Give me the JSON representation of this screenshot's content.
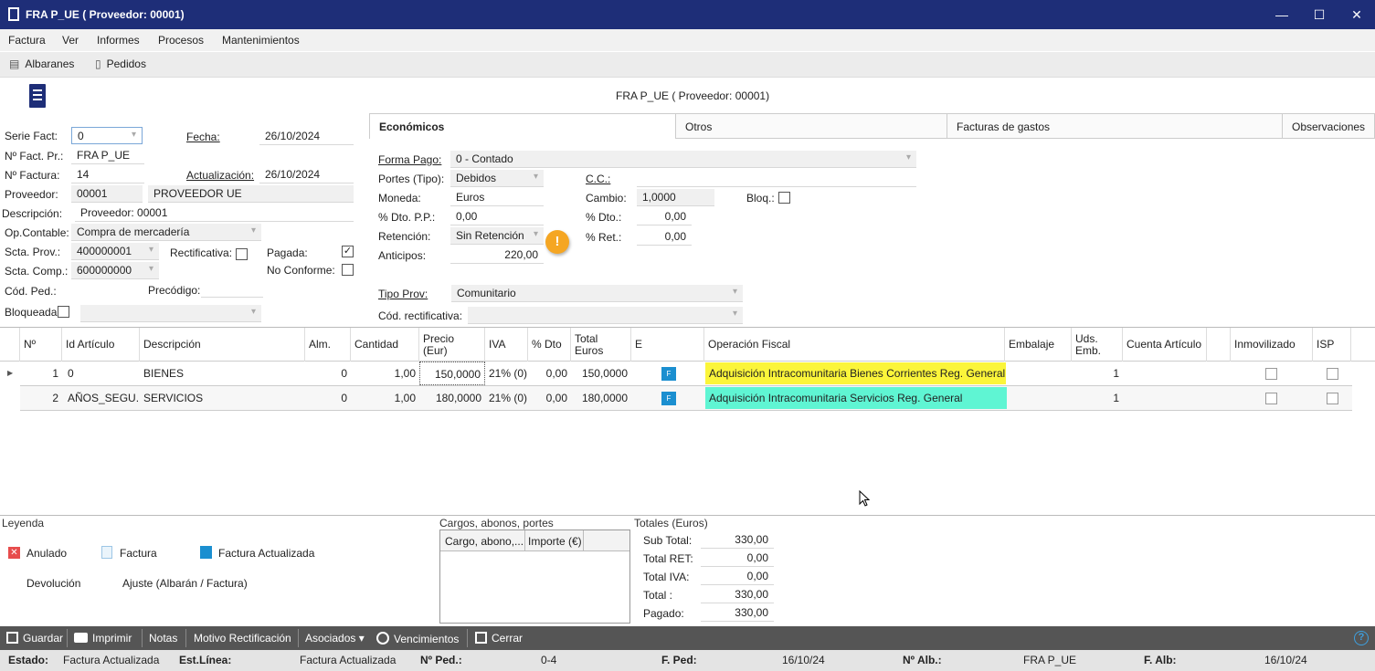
{
  "window": {
    "title": "FRA P_UE ( Proveedor: 00001)",
    "minimize": "—",
    "maximize": "☐",
    "close": "✕"
  },
  "menu": [
    "Factura",
    "Ver",
    "Informes",
    "Procesos",
    "Mantenimientos"
  ],
  "toolbar": {
    "albaranes": "Albaranes",
    "pedidos": "Pedidos"
  },
  "header_caption": "FRA P_UE ( Proveedor: 00001)",
  "left": {
    "serie_label": "Serie Fact:",
    "serie_value": "0",
    "fecha_label": "Fecha:",
    "fecha_value": "26/10/2024",
    "nfactpr_label": "Nº Fact. Pr.:",
    "nfactpr_value": "FRA P_UE",
    "nfactura_label": "Nº Factura:",
    "nfactura_value": "14",
    "actualizacion_label": "Actualización:",
    "actualizacion_value": "26/10/2024",
    "proveedor_label": "Proveedor:",
    "proveedor_code": "00001",
    "proveedor_name": "PROVEEDOR UE",
    "descripcion_label": "Descripción:",
    "descripcion_value": "Proveedor: 00001",
    "opcontable_label": "Op.Contable:",
    "opcontable_value": "Compra de mercadería",
    "sctaprov_label": "Scta. Prov.:",
    "sctaprov_value": "400000001",
    "rectificativa_label": "Rectificativa:",
    "pagada_label": "Pagada:",
    "pagada_check": "✓",
    "sctacomp_label": "Scta. Comp.:",
    "sctacomp_value": "600000000",
    "noconforme_label": "No Conforme:",
    "codped_label": "Cód. Ped.:",
    "precodigo_label": "Precódigo:",
    "bloqueada_label": "Bloqueada"
  },
  "tabs": [
    "Económicos",
    "Otros",
    "Facturas de gastos",
    "Observaciones"
  ],
  "econ": {
    "formapago_label": "Forma Pago:",
    "formapago_value": "0 - Contado",
    "portes_label": "Portes (Tipo):",
    "portes_value": "Debidos",
    "cc_label": "C.C.:",
    "moneda_label": "Moneda:",
    "moneda_value": "Euros",
    "cambio_label": "Cambio:",
    "cambio_value": "1,0000",
    "bloq_label": "Bloq.:",
    "dtopp_label": "% Dto. P.P.:",
    "dtopp_value": "0,00",
    "dto_label": "% Dto.:",
    "dto_value": "0,00",
    "retencion_label": "Retención:",
    "retencion_value": "Sin Retención",
    "ret_label": "% Ret.:",
    "ret_value": "0,00",
    "anticipos_label": "Anticipos:",
    "anticipos_value": "220,00",
    "warning_glyph": "!",
    "tipoprov_label": "Tipo Prov:",
    "tipoprov_value": "Comunitario",
    "codrect_label": "Cód. rectificativa:"
  },
  "grid": {
    "headers": [
      "Nº",
      "Id Artículo",
      "Descripción",
      "Alm.",
      "Cantidad",
      "Precio (Eur)",
      "IVA",
      "% Dto",
      "Total Euros",
      "E",
      "Operación Fiscal",
      "Embalaje",
      "Uds. Emb.",
      "Cuenta Artículo",
      "",
      "Inmovilizado",
      "ISP"
    ],
    "rows": [
      {
        "n": "1",
        "id": "0",
        "desc": "BIENES",
        "alm": "0",
        "cant": "1,00",
        "precio": "150,0000",
        "iva": "21% (0)",
        "dto": "0,00",
        "total": "150,0000",
        "e": "F",
        "opfiscal": "Adquisición Intracomunitaria Bienes Corrientes Reg. General",
        "emb": "",
        "uds": "1",
        "opcolor": "#fbf53a"
      },
      {
        "n": "2",
        "id": "AÑOS_SEGU...",
        "desc": "SERVICIOS",
        "alm": "0",
        "cant": "1,00",
        "precio": "180,0000",
        "iva": "21% (0)",
        "dto": "0,00",
        "total": "180,0000",
        "e": "F",
        "opfiscal": "Adquisición Intracomunitaria Servicios Reg. General",
        "emb": "",
        "uds": "1",
        "opcolor": "#5ff5d3"
      }
    ]
  },
  "legend": {
    "title": "Leyenda",
    "anulado": "Anulado",
    "factura": "Factura",
    "factura_actualizada": "Factura Actualizada",
    "devolucion": "Devolución",
    "ajuste": "Ajuste  (Albarán / Factura)",
    "anulado_color": "#e74c4c",
    "actualizada_color": "#1b8fd0"
  },
  "cargos": {
    "title": "Cargos, abonos, portes",
    "col1": "Cargo, abono,...",
    "col2": "Importe (€)"
  },
  "totales": {
    "title": "Totales (Euros)",
    "subtotal_label": "Sub Total:",
    "subtotal": "330,00",
    "totalret_label": "Total RET:",
    "totalret": "0,00",
    "totaliva_label": "Total IVA:",
    "totaliva": "0,00",
    "total_label": "Total :",
    "total": "330,00",
    "pagado_label": "Pagado:",
    "pagado": "330,00"
  },
  "actions": [
    "Guardar",
    "Imprimir",
    "Notas",
    "Motivo Rectificación",
    "Asociados ▾",
    "Vencimientos",
    "Cerrar"
  ],
  "help_glyph": "?",
  "status": {
    "estado_label": "Estado:",
    "estado": "Factura Actualizada",
    "estlinea_label": "Est.Línea:",
    "estlinea": "Factura Actualizada",
    "nped_label": "Nº Ped.:",
    "nped": "0-4",
    "fped_label": "F. Ped:",
    "fped": "16/10/24",
    "nalb_label": "Nº Alb.:",
    "nalb": "FRA P_UE",
    "falb_label": "F. Alb:",
    "falb": "16/10/24"
  }
}
